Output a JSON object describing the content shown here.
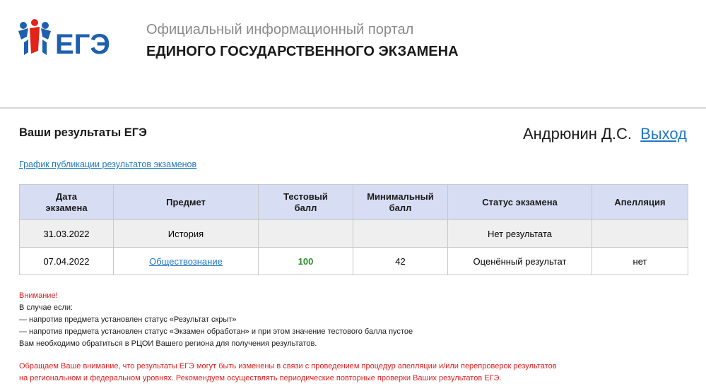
{
  "header": {
    "logo_text": "ЕГЭ",
    "portal_line1": "Официальный информационный портал",
    "portal_line2": "ЕДИНОГО ГОСУДАРСТВЕННОГО ЭКЗАМЕНА",
    "brand_colors": {
      "blue": "#1f5fb0",
      "red": "#e2231a"
    }
  },
  "main": {
    "title": "Ваши результаты ЕГЭ",
    "user_name": "Андрюнин Д.С.",
    "logout_label": "Выход",
    "schedule_link": "График публикации результатов экзаменов"
  },
  "table": {
    "headers": {
      "date_line1": "Дата",
      "date_line2": "экзамена",
      "subject": "Предмет",
      "score_line1": "Тестовый",
      "score_line2": "балл",
      "min_line1": "Минимальный",
      "min_line2": "балл",
      "status": "Статус экзамена",
      "appeal": "Апелляция"
    },
    "rows": [
      {
        "date": "31.03.2022",
        "subject": "История",
        "score": "",
        "min_score": "",
        "status": "Нет результата",
        "appeal": ""
      },
      {
        "date": "07.04.2022",
        "subject": "Обществознание",
        "score": "100",
        "min_score": "42",
        "status": "Оценённый результат",
        "appeal": "нет"
      }
    ]
  },
  "notes": {
    "attention": "Внимание!",
    "line1": "В случае если:",
    "line2": "— напротив предмета установлен статус «Результат скрыт»",
    "line3": "— напротив предмета установлен статус «Экзамен обработан» и при этом значение тестового балла пустое",
    "line4": "Вам необходимо обратиться в РЦОИ Вашего региона для получения результатов."
  },
  "notice": {
    "line1": "Обращаем Ваше внимание, что результаты ЕГЭ могут быть изменены в связи с проведением процедур апелляции и/или перепроверок результатов",
    "line2": "на региональном и федеральном уровнях. Рекомендуем осуществлять периодические повторные проверки Ваших результатов ЕГЭ."
  }
}
